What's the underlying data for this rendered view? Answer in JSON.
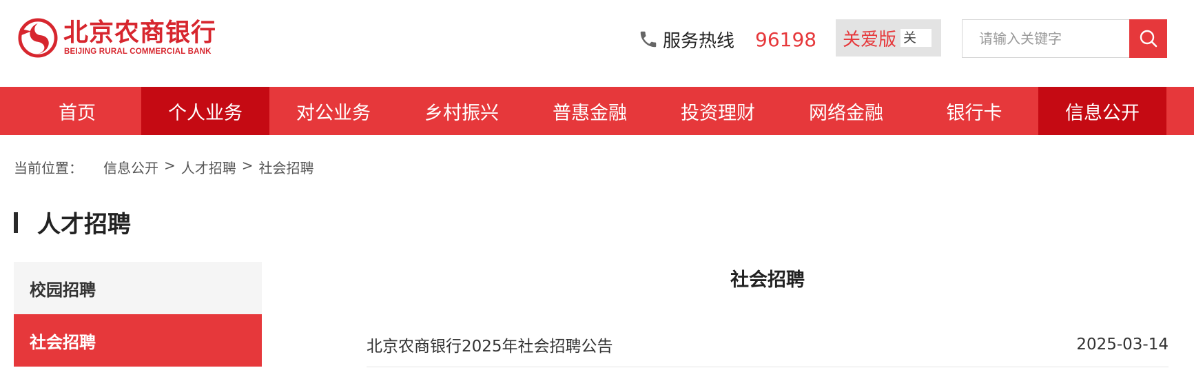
{
  "header": {
    "logo": {
      "name_cn": "北京农商银行",
      "name_en": "BEIJING RURAL COMMERCIAL BANK",
      "icon": "bank-logo-icon"
    },
    "hotline": {
      "icon": "phone-icon",
      "label": "服务热线",
      "number": "96198"
    },
    "care_mode": {
      "label": "关爱版",
      "toggle_label": "关"
    },
    "search": {
      "placeholder": "请输入关键字",
      "value": "",
      "icon": "search-icon"
    }
  },
  "nav": {
    "items": [
      {
        "label": "首页"
      },
      {
        "label": "个人业务"
      },
      {
        "label": "对公业务"
      },
      {
        "label": "乡村振兴"
      },
      {
        "label": "普惠金融"
      },
      {
        "label": "投资理财"
      },
      {
        "label": "网络金融"
      },
      {
        "label": "银行卡"
      },
      {
        "label": "信息公开"
      }
    ]
  },
  "breadcrumb": {
    "prefix": "当前位置：",
    "items": [
      "信息公开",
      "人才招聘",
      "社会招聘"
    ],
    "separator": ">"
  },
  "section": {
    "title": "人才招聘"
  },
  "sidebar": {
    "items": [
      {
        "label": "校园招聘"
      },
      {
        "label": "社会招聘"
      }
    ]
  },
  "main": {
    "title": "社会招聘",
    "articles": [
      {
        "title": "北京农商银行2025年社会招聘公告",
        "date": "2025-03-14"
      }
    ]
  },
  "colors": {
    "brand_red": "#e6383b",
    "active_red": "#c50a13",
    "logo_red": "#d7262e"
  }
}
